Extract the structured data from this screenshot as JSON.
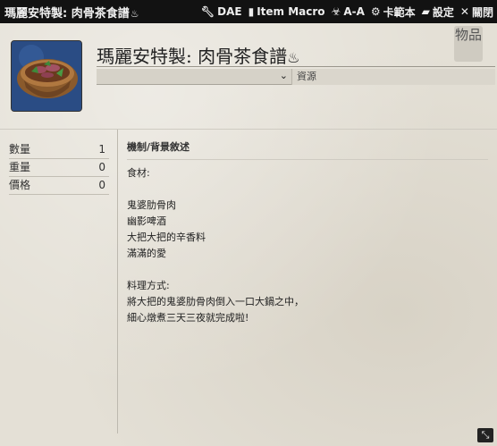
{
  "titlebar": {
    "title": "瑪麗安特製: 肉骨茶食譜",
    "title_icon": "cooking-pot-icon",
    "buttons": [
      {
        "icon": "wrench-icon",
        "label": "DAE"
      },
      {
        "icon": "sticky-note-icon",
        "label": "Item Macro"
      },
      {
        "icon": "biohazard-icon",
        "label": "A-A"
      },
      {
        "icon": "gear-icon",
        "label": "卡範本"
      },
      {
        "icon": "crate-icon",
        "label": "設定"
      },
      {
        "icon": "close-icon",
        "label": "關閉"
      }
    ]
  },
  "item": {
    "name": "瑪麗安特製: 肉骨茶食譜",
    "type_tag": "物品",
    "source_placeholder": "資源"
  },
  "stats": [
    {
      "label": "數量",
      "value": "1"
    },
    {
      "label": "重量",
      "value": "0"
    },
    {
      "label": "價格",
      "value": "0"
    }
  ],
  "description": {
    "heading": "機制/背景敘述",
    "lines": [
      "食材:",
      "",
      "鬼婆肋骨肉",
      "幽影啤酒",
      "大把大把的辛香料",
      "滿滿的愛",
      "",
      "料理方式:",
      "將大把的鬼婆肋骨肉倒入一口大鍋之中，",
      "細心燉煮三天三夜就完成啦!"
    ]
  },
  "colors": {
    "titlebar_bg": "#121212",
    "sheet_bg": "#e4e0d6",
    "portrait_bg": "#2c4f86"
  }
}
